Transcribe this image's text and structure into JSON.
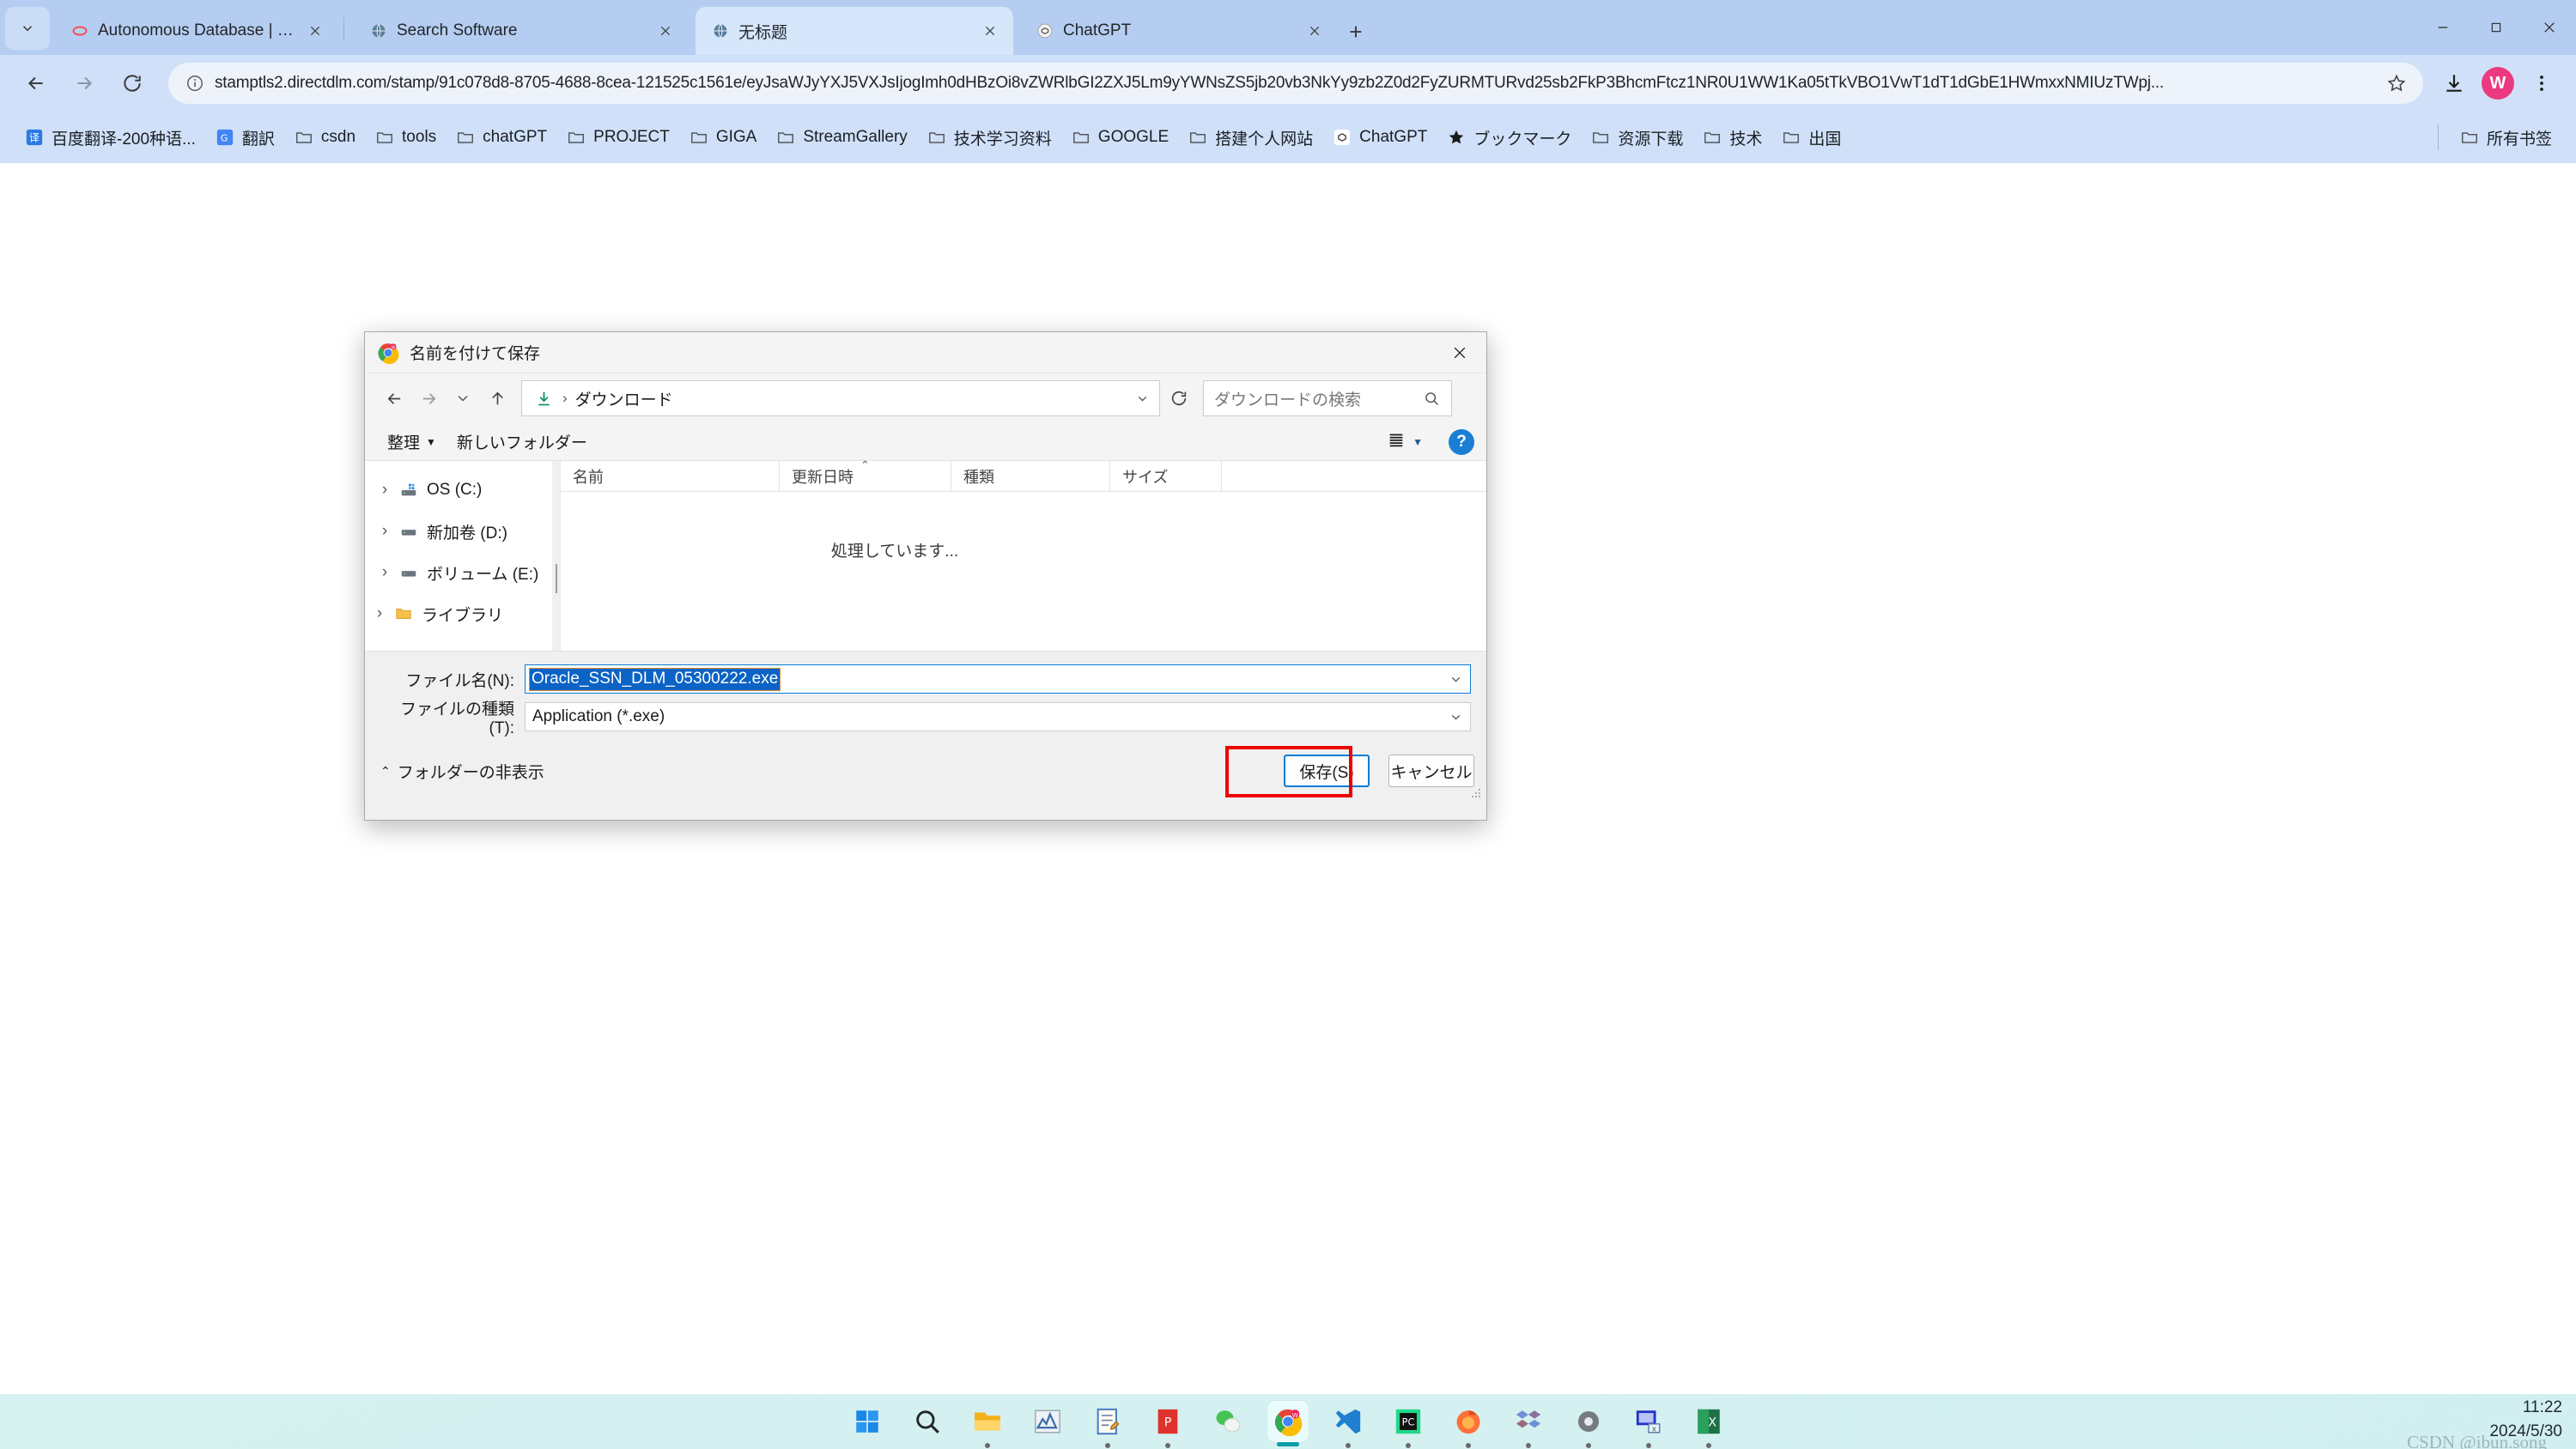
{
  "browser": {
    "tabs": [
      {
        "title": "Autonomous Database | Oracle",
        "favicon": "oracle-icon",
        "active": false
      },
      {
        "title": "Search Software",
        "favicon": "globe-icon",
        "active": false
      },
      {
        "title": "无标题",
        "favicon": "globe-icon",
        "active": true
      },
      {
        "title": "ChatGPT",
        "favicon": "chatgpt-icon",
        "active": false
      }
    ],
    "new_tab_label": "+",
    "window_controls": {
      "minimize": "—",
      "maximize": "▢",
      "close": "✕"
    },
    "nav": {
      "back": "←",
      "forward": "→",
      "reload": "⟳"
    },
    "omnibox": {
      "url": "stamptls2.directdlm.com/stamp/91c078d8-8705-4688-8cea-121525c1561e/eyJsaWJyYXJ5VXJsIjogImh0dHBzOi8vZWRlbGI2ZXJ5Lm9yYWNsZS5jb20vb3NkYy9zb2Z0d2FyZURMTURvd25sb2FkP3BhcmFtcz1NR0U1WW1Ka05tTkVBO1VwT1dT1dGbE1HWmxxNMIUzTWpj...",
      "site_info_icon": "info-circle-icon",
      "star_icon": "bookmark-star-icon"
    },
    "toolbar_icons": [
      "download-icon",
      "profile-avatar",
      "chrome-menu-icon"
    ],
    "profile_initial": "W",
    "bookmarks": [
      {
        "label": "百度翻译-200种语...",
        "icon": "baidu-translate-icon"
      },
      {
        "label": "翻訳",
        "icon": "google-translate-icon"
      },
      {
        "label": "csdn",
        "icon": "folder-icon"
      },
      {
        "label": "tools",
        "icon": "folder-icon"
      },
      {
        "label": "chatGPT",
        "icon": "folder-icon"
      },
      {
        "label": "PROJECT",
        "icon": "folder-icon"
      },
      {
        "label": "GIGA",
        "icon": "folder-icon"
      },
      {
        "label": "StreamGallery",
        "icon": "folder-icon"
      },
      {
        "label": "技术学习资料",
        "icon": "folder-icon"
      },
      {
        "label": "GOOGLE",
        "icon": "folder-icon"
      },
      {
        "label": "搭建个人网站",
        "icon": "folder-icon"
      },
      {
        "label": "ChatGPT",
        "icon": "chatgpt-icon"
      },
      {
        "label": "ブックマーク",
        "icon": "star-icon"
      },
      {
        "label": "资源下载",
        "icon": "folder-icon"
      },
      {
        "label": "技术",
        "icon": "folder-icon"
      },
      {
        "label": "出国",
        "icon": "folder-icon"
      }
    ],
    "bookmarks_overflow": {
      "label": "所有书签",
      "icon": "folder-icon"
    }
  },
  "dialog": {
    "title": "名前を付けて保存",
    "title_icon": "chrome-icon",
    "close_label": "✕",
    "nav": {
      "back": "←",
      "forward": "→",
      "recent": "⌄",
      "up": "↑",
      "refresh": "⟳"
    },
    "breadcrumb": {
      "icon": "downloads-icon",
      "path": "ダウンロード",
      "separator": "›"
    },
    "search": {
      "placeholder": "ダウンロードの検索",
      "icon": "search-icon"
    },
    "commands": {
      "organize": "整理",
      "organize_caret": "▼",
      "new_folder": "新しいフォルダー"
    },
    "view": {
      "icon": "list-view-icon",
      "caret": "▼"
    },
    "help_label": "?",
    "nav_pane": [
      {
        "label": "OS (C:)",
        "icon": "hard-drive-icon",
        "expander": "›"
      },
      {
        "label": "新加卷 (D:)",
        "icon": "drive-icon",
        "expander": "›"
      },
      {
        "label": "ボリューム (E:)",
        "icon": "drive-icon",
        "expander": "›"
      },
      {
        "label": "ライブラリ",
        "icon": "folder-icon",
        "expander": "›"
      }
    ],
    "columns": [
      {
        "label": "名前",
        "sorted": false
      },
      {
        "label": "更新日時",
        "sorted": true,
        "sort_arrow": "⌃"
      },
      {
        "label": "種類",
        "sorted": false
      },
      {
        "label": "サイズ",
        "sorted": false
      }
    ],
    "list_status": "処理しています...",
    "fields": {
      "filename_label": "ファイル名(N):",
      "filename_value": "Oracle_SSN_DLM_05300222.exe",
      "filetype_label": "ファイルの種類(T):",
      "filetype_value": "Application (*.exe)",
      "caret": "⌄"
    },
    "footer": {
      "hide_folders": "フォルダーの非表示",
      "hide_folders_caret": "⌃",
      "save_button": "保存(S)",
      "cancel_button": "キャンセル"
    },
    "highlight_color": "#ee0000"
  },
  "taskbar": {
    "apps": [
      {
        "name": "start-icon",
        "running": false,
        "active": false
      },
      {
        "name": "search-icon",
        "running": false,
        "active": false
      },
      {
        "name": "file-explorer-icon",
        "running": true,
        "active": false
      },
      {
        "name": "charts-app-icon",
        "running": false,
        "active": false
      },
      {
        "name": "notepad-icon",
        "running": true,
        "active": false
      },
      {
        "name": "pdf-reader-icon",
        "running": true,
        "active": false
      },
      {
        "name": "wechat-icon",
        "running": false,
        "active": false
      },
      {
        "name": "chrome-icon",
        "running": true,
        "active": true
      },
      {
        "name": "vscode-icon",
        "running": true,
        "active": false
      },
      {
        "name": "pycharm-icon",
        "running": true,
        "active": false
      },
      {
        "name": "firefox-icon",
        "running": true,
        "active": false
      },
      {
        "name": "dropbox-icon",
        "running": true,
        "active": false
      },
      {
        "name": "settings-icon",
        "running": true,
        "active": false
      },
      {
        "name": "remote-desktop-icon",
        "running": true,
        "active": false
      },
      {
        "name": "excel-icon",
        "running": true,
        "active": false
      }
    ],
    "clock_time": "11:22",
    "clock_date": "2024/5/30",
    "watermark": "CSDN @ibun.song"
  }
}
